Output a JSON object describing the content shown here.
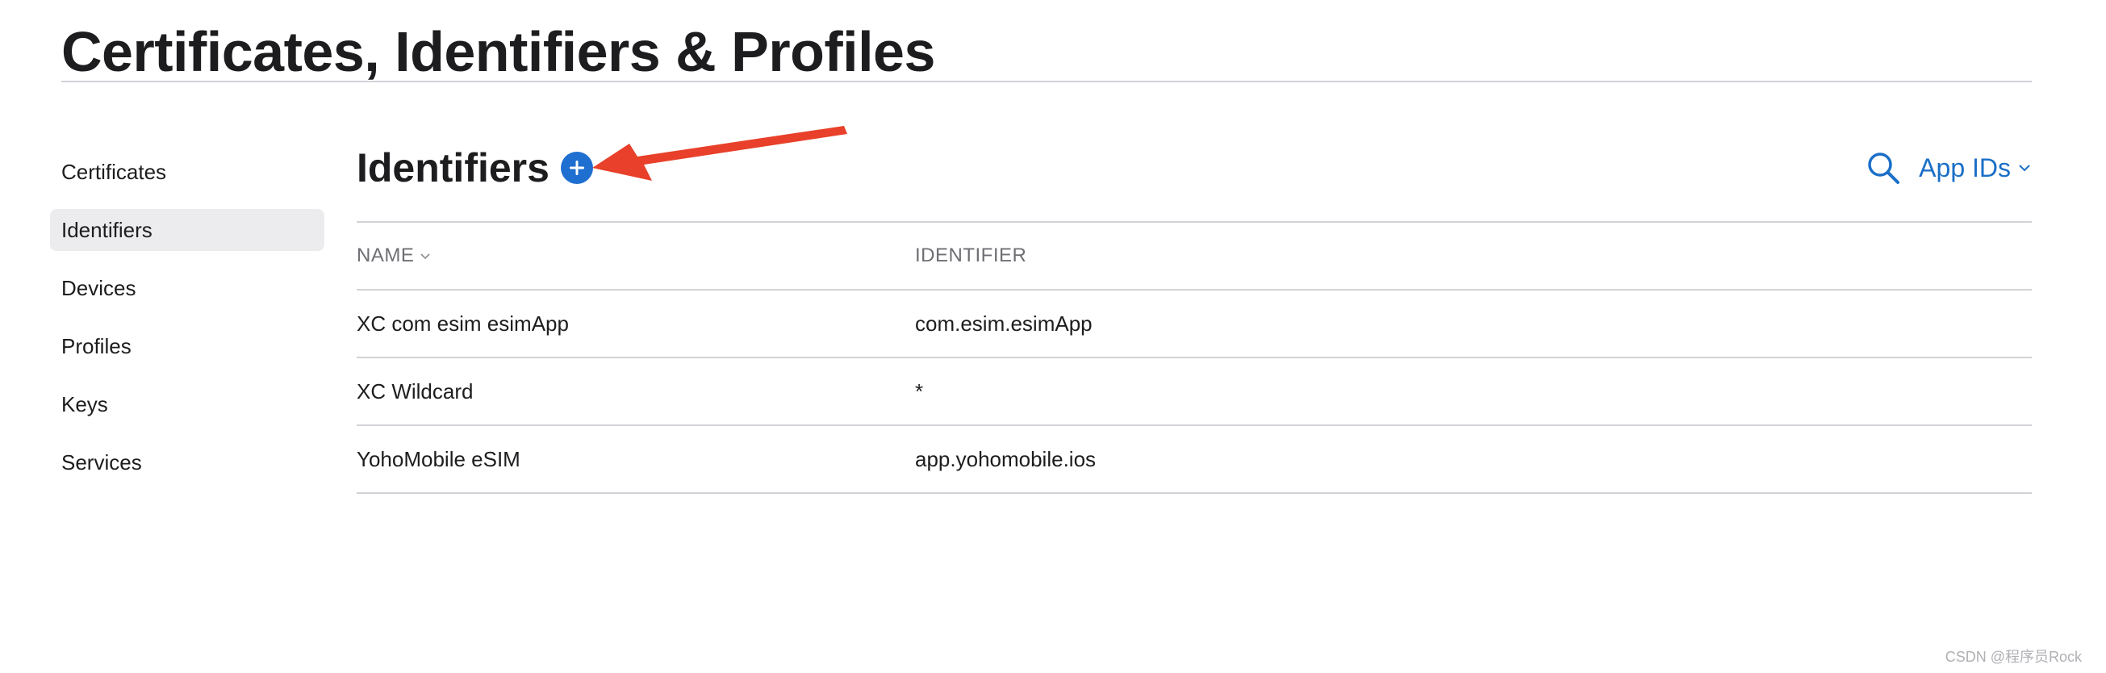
{
  "page": {
    "title": "Certificates, Identifiers & Profiles"
  },
  "sidebar": {
    "items": [
      {
        "label": "Certificates",
        "active": false
      },
      {
        "label": "Identifiers",
        "active": true
      },
      {
        "label": "Devices",
        "active": false
      },
      {
        "label": "Profiles",
        "active": false
      },
      {
        "label": "Keys",
        "active": false
      },
      {
        "label": "Services",
        "active": false
      }
    ]
  },
  "section": {
    "title": "Identifiers",
    "add_icon": "plus-circle-icon",
    "annotation_color": "#e8402a"
  },
  "controls": {
    "search_icon": "search-icon",
    "filter_value": "App IDs"
  },
  "table": {
    "columns": [
      "NAME",
      "IDENTIFIER"
    ],
    "rows": [
      {
        "name": "XC com esim esimApp",
        "identifier": "com.esim.esimApp"
      },
      {
        "name": "XC Wildcard",
        "identifier": "*"
      },
      {
        "name": "YohoMobile eSIM",
        "identifier": "app.yohomobile.ios"
      }
    ]
  },
  "watermark": "CSDN @程序员Rock",
  "colors": {
    "accent": "#1a6fc7",
    "add_button": "#1e6fd0",
    "annotation_arrow": "#e8402a",
    "divider": "#d2d2d7",
    "active_sidebar_bg": "#ececee"
  }
}
